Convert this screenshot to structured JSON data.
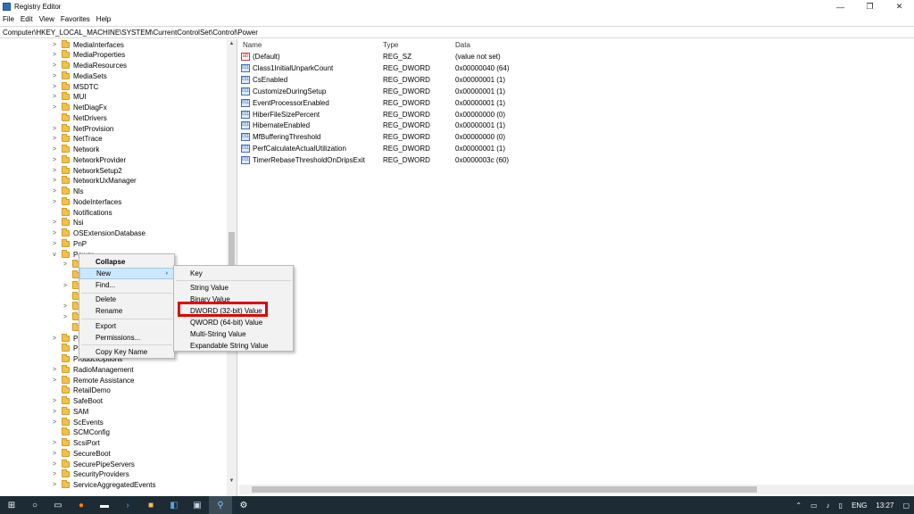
{
  "window": {
    "title": "Registry Editor",
    "minimize": "—",
    "maximize": "❐",
    "close": "✕"
  },
  "menu": [
    "File",
    "Edit",
    "View",
    "Favorites",
    "Help"
  ],
  "address": "Computer\\HKEY_LOCAL_MACHINE\\SYSTEM\\CurrentControlSet\\Control\\Power",
  "tree": [
    {
      "label": "MediaInterfaces",
      "chev": ">",
      "indent": 0
    },
    {
      "label": "MediaProperties",
      "chev": ">",
      "indent": 0
    },
    {
      "label": "MediaResources",
      "chev": ">",
      "indent": 0
    },
    {
      "label": "MediaSets",
      "chev": ">",
      "indent": 0
    },
    {
      "label": "MSDTC",
      "chev": ">",
      "indent": 0
    },
    {
      "label": "MUI",
      "chev": ">",
      "indent": 0
    },
    {
      "label": "NetDiagFx",
      "chev": ">",
      "indent": 0
    },
    {
      "label": "NetDrivers",
      "chev": "",
      "indent": 0
    },
    {
      "label": "NetProvision",
      "chev": ">",
      "indent": 0
    },
    {
      "label": "NetTrace",
      "chev": ">",
      "indent": 0
    },
    {
      "label": "Network",
      "chev": ">",
      "indent": 0
    },
    {
      "label": "NetworkProvider",
      "chev": ">",
      "indent": 0
    },
    {
      "label": "NetworkSetup2",
      "chev": ">",
      "indent": 0
    },
    {
      "label": "NetworkUxManager",
      "chev": ">",
      "indent": 0
    },
    {
      "label": "Nls",
      "chev": ">",
      "indent": 0
    },
    {
      "label": "NodeInterfaces",
      "chev": ">",
      "indent": 0
    },
    {
      "label": "Notifications",
      "chev": "",
      "indent": 0
    },
    {
      "label": "Nsi",
      "chev": ">",
      "indent": 0
    },
    {
      "label": "OSExtensionDatabase",
      "chev": ">",
      "indent": 0
    },
    {
      "label": "PnP",
      "chev": ">",
      "indent": 0
    },
    {
      "label": "Power",
      "chev": "v",
      "indent": 0
    },
    {
      "label": "",
      "chev": ">",
      "indent": 1
    },
    {
      "label": "",
      "chev": "",
      "indent": 1
    },
    {
      "label": "",
      "chev": ">",
      "indent": 1
    },
    {
      "label": "",
      "chev": "",
      "indent": 1
    },
    {
      "label": "",
      "chev": ">",
      "indent": 1
    },
    {
      "label": "",
      "chev": ">",
      "indent": 1
    },
    {
      "label": "",
      "chev": "",
      "indent": 1
    },
    {
      "label": "Pri",
      "chev": ">",
      "indent": 0
    },
    {
      "label": "PriorityControl",
      "chev": "",
      "indent": 0
    },
    {
      "label": "ProductOptions",
      "chev": "",
      "indent": 0
    },
    {
      "label": "RadioManagement",
      "chev": ">",
      "indent": 0
    },
    {
      "label": "Remote Assistance",
      "chev": ">",
      "indent": 0
    },
    {
      "label": "RetailDemo",
      "chev": "",
      "indent": 0
    },
    {
      "label": "SafeBoot",
      "chev": ">",
      "indent": 0
    },
    {
      "label": "SAM",
      "chev": ">",
      "indent": 0
    },
    {
      "label": "ScEvents",
      "chev": ">",
      "indent": 0
    },
    {
      "label": "SCMConfig",
      "chev": "",
      "indent": 0
    },
    {
      "label": "ScsiPort",
      "chev": ">",
      "indent": 0
    },
    {
      "label": "SecureBoot",
      "chev": ">",
      "indent": 0
    },
    {
      "label": "SecurePipeServers",
      "chev": ">",
      "indent": 0
    },
    {
      "label": "SecurityProviders",
      "chev": ">",
      "indent": 0
    },
    {
      "label": "ServiceAggregatedEvents",
      "chev": ">",
      "indent": 0
    }
  ],
  "columns": {
    "name": "Name",
    "type": "Type",
    "data": "Data"
  },
  "values": [
    {
      "icon": "ab",
      "name": "(Default)",
      "type": "REG_SZ",
      "data": "(value not set)"
    },
    {
      "icon": "011",
      "name": "Class1InitialUnparkCount",
      "type": "REG_DWORD",
      "data": "0x00000040 (64)"
    },
    {
      "icon": "011",
      "name": "CsEnabled",
      "type": "REG_DWORD",
      "data": "0x00000001 (1)"
    },
    {
      "icon": "011",
      "name": "CustomizeDuringSetup",
      "type": "REG_DWORD",
      "data": "0x00000001 (1)"
    },
    {
      "icon": "011",
      "name": "EventProcessorEnabled",
      "type": "REG_DWORD",
      "data": "0x00000001 (1)"
    },
    {
      "icon": "011",
      "name": "HiberFileSizePercent",
      "type": "REG_DWORD",
      "data": "0x00000000 (0)"
    },
    {
      "icon": "011",
      "name": "HibernateEnabled",
      "type": "REG_DWORD",
      "data": "0x00000001 (1)"
    },
    {
      "icon": "011",
      "name": "MfBufferingThreshold",
      "type": "REG_DWORD",
      "data": "0x00000000 (0)"
    },
    {
      "icon": "011",
      "name": "PerfCalculateActualUtilization",
      "type": "REG_DWORD",
      "data": "0x00000001 (1)"
    },
    {
      "icon": "011",
      "name": "TimerRebaseThresholdOnDripsExit",
      "type": "REG_DWORD",
      "data": "0x0000003c (60)"
    }
  ],
  "context_menu": {
    "collapse": "Collapse",
    "new": "New",
    "find": "Find...",
    "delete": "Delete",
    "rename": "Rename",
    "export": "Export",
    "permissions": "Permissions...",
    "copy_key_name": "Copy Key Name"
  },
  "submenu": {
    "key": "Key",
    "string_value": "String Value",
    "binary_value": "Binary Value",
    "dword": "DWORD (32-bit) Value",
    "qword": "QWORD (64-bit) Value",
    "multi_string": "Multi-String Value",
    "expandable_string": "Expandable String Value"
  },
  "taskbar": {
    "language": "ENG",
    "time": "13:27"
  }
}
